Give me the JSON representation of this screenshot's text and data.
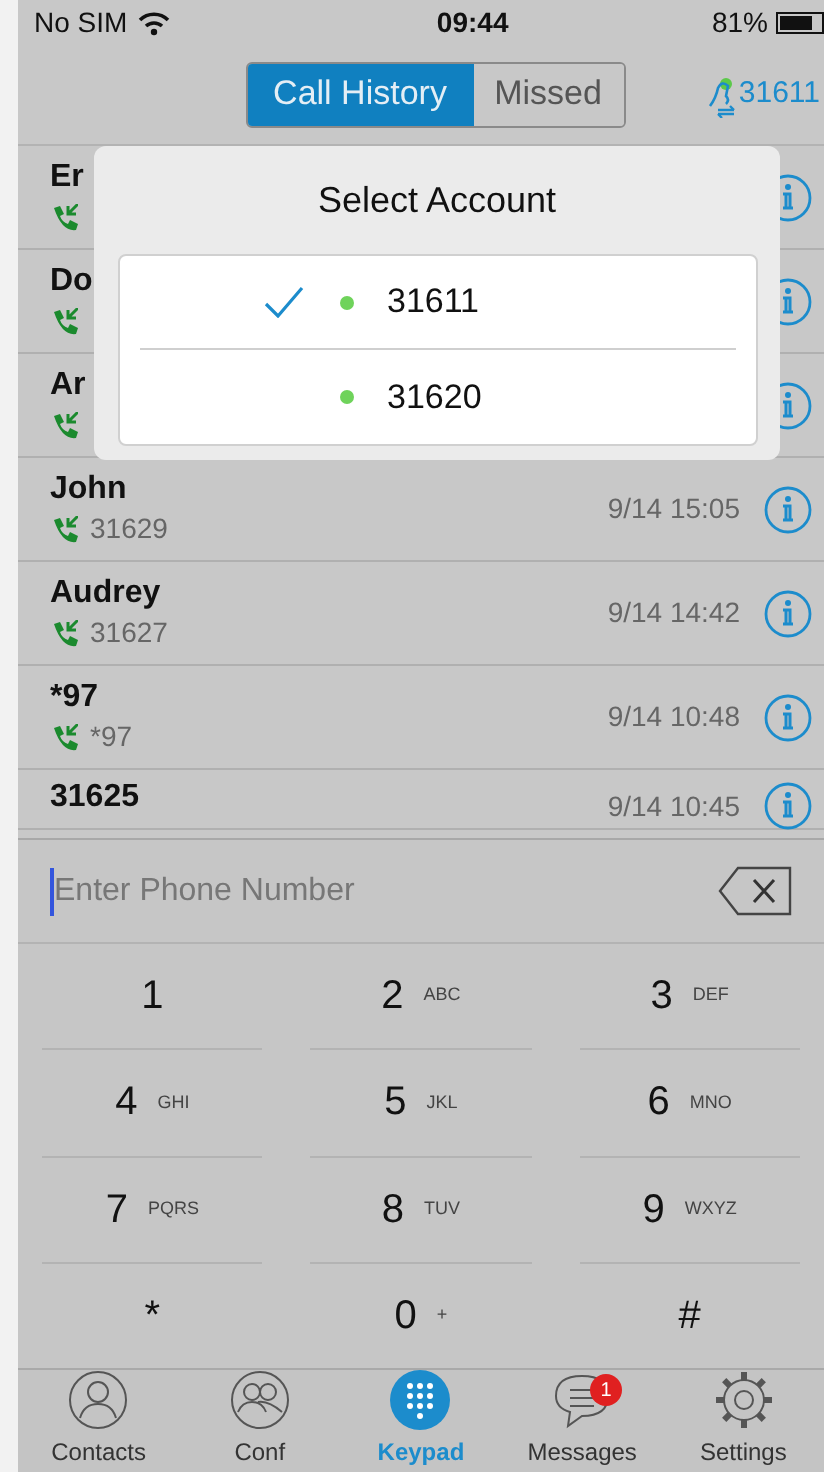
{
  "status_bar": {
    "carrier": "No SIM",
    "time": "09:44",
    "battery": "81%"
  },
  "header": {
    "segments": [
      {
        "label": "Call History",
        "selected": true
      },
      {
        "label": "Missed",
        "selected": false
      }
    ],
    "account": "31611"
  },
  "calls": [
    {
      "name": "Er"
    },
    {
      "name": "Do"
    },
    {
      "name": "Ar"
    },
    {
      "name": "John",
      "number": "31629",
      "time": "9/14 15:05"
    },
    {
      "name": "Audrey",
      "number": "31627",
      "time": "9/14 14:42"
    },
    {
      "name": "*97",
      "number": "*97",
      "time": "9/14 10:48"
    },
    {
      "name": "31625",
      "time": "9/14 10:45"
    }
  ],
  "account_popup": {
    "title": "Select Account",
    "accounts": [
      {
        "number": "31611",
        "selected": true,
        "color": "#6fd35b"
      },
      {
        "number": "31620",
        "selected": false,
        "color": "#6fd35b"
      }
    ]
  },
  "dialer": {
    "placeholder": "Enter Phone Number",
    "keys": [
      {
        "digit": "1"
      },
      {
        "digit": "2",
        "letters": "ABC"
      },
      {
        "digit": "3",
        "letters": "DEF"
      },
      {
        "digit": "4",
        "letters": "GHI"
      },
      {
        "digit": "5",
        "letters": "JKL"
      },
      {
        "digit": "6",
        "letters": "MNO"
      },
      {
        "digit": "7",
        "letters": "PQRS"
      },
      {
        "digit": "8",
        "letters": "TUV"
      },
      {
        "digit": "9",
        "letters": "WXYZ"
      },
      {
        "digit": "*"
      },
      {
        "digit": "0",
        "letters": "+"
      },
      {
        "digit": "#"
      }
    ]
  },
  "tab_bar": [
    {
      "label": "Contacts",
      "selected": false
    },
    {
      "label": "Conf",
      "selected": false
    },
    {
      "label": "Keypad",
      "selected": true
    },
    {
      "label": "Messages",
      "selected": false,
      "badge": "1"
    },
    {
      "label": "Settings",
      "selected": false
    }
  ]
}
